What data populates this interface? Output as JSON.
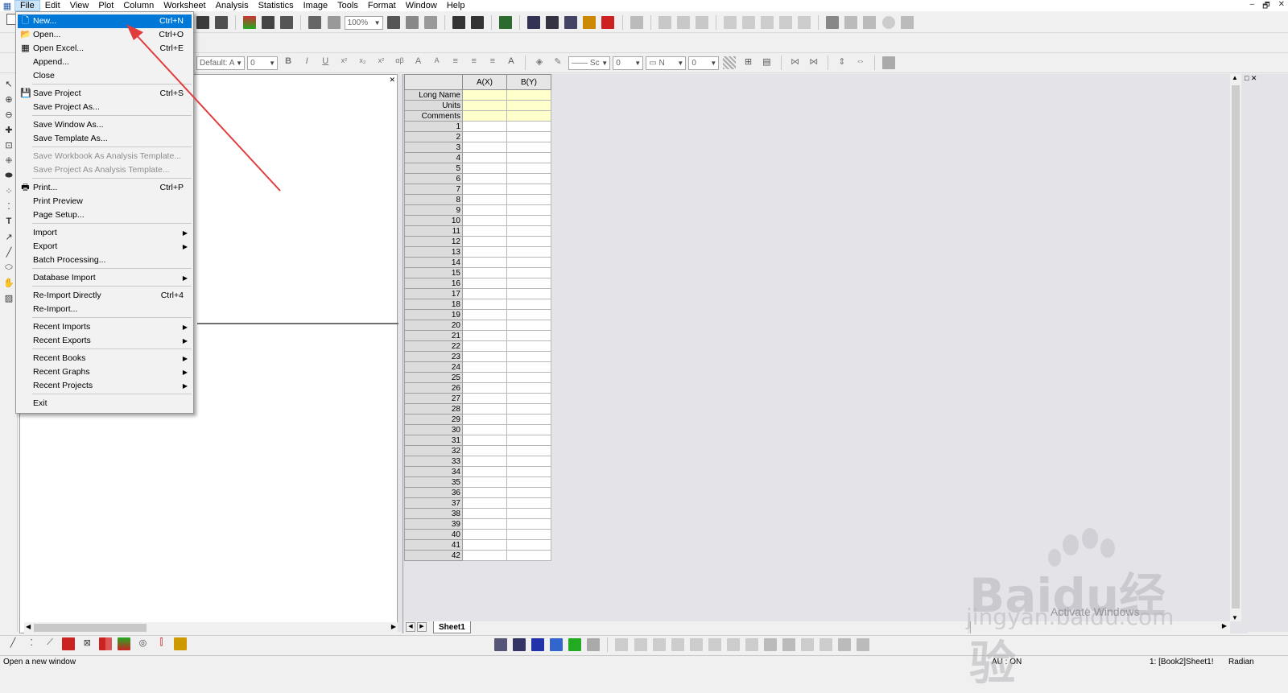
{
  "menubar": {
    "items": [
      "File",
      "Edit",
      "View",
      "Plot",
      "Column",
      "Worksheet",
      "Analysis",
      "Statistics",
      "Image",
      "Tools",
      "Format",
      "Window",
      "Help"
    ]
  },
  "window_controls": {
    "minimize": "–",
    "restore": "🗗",
    "close": "✕"
  },
  "toolbar": {
    "zoom": "100%",
    "font_combo": "Default: A",
    "font_size": "0",
    "line_style": "Sc",
    "line_width": "0",
    "border_combo": "N",
    "border_width": "0"
  },
  "file_menu": {
    "items": [
      {
        "label": "New...",
        "shortcut": "Ctrl+N",
        "icon": "new-icon"
      },
      {
        "label": "Open...",
        "shortcut": "Ctrl+O",
        "icon": "open-folder-icon"
      },
      {
        "label": "Open Excel...",
        "shortcut": "Ctrl+E",
        "icon": "excel-icon"
      },
      {
        "label": "Append...",
        "shortcut": ""
      },
      {
        "label": "Close",
        "shortcut": ""
      },
      {
        "label": "Save Project",
        "shortcut": "Ctrl+S",
        "icon": "save-icon"
      },
      {
        "label": "Save Project As...",
        "shortcut": ""
      },
      {
        "label": "Save Window As...",
        "shortcut": ""
      },
      {
        "label": "Save Template As...",
        "shortcut": ""
      },
      {
        "label": "Save Workbook As Analysis Template...",
        "shortcut": ""
      },
      {
        "label": "Save Project As Analysis Template...",
        "shortcut": ""
      },
      {
        "label": "Print...",
        "shortcut": "Ctrl+P",
        "icon": "printer-icon"
      },
      {
        "label": "Print Preview",
        "shortcut": ""
      },
      {
        "label": "Page Setup...",
        "shortcut": ""
      },
      {
        "label": "Import",
        "shortcut": ""
      },
      {
        "label": "Export",
        "shortcut": ""
      },
      {
        "label": "Batch Processing...",
        "shortcut": ""
      },
      {
        "label": "Database Import",
        "shortcut": ""
      },
      {
        "label": "Re-Import Directly",
        "shortcut": "Ctrl+4"
      },
      {
        "label": "Re-Import...",
        "shortcut": ""
      },
      {
        "label": "Recent Imports",
        "shortcut": ""
      },
      {
        "label": "Recent Exports",
        "shortcut": ""
      },
      {
        "label": "Recent Books",
        "shortcut": ""
      },
      {
        "label": "Recent Graphs",
        "shortcut": ""
      },
      {
        "label": "Recent Projects",
        "shortcut": ""
      },
      {
        "label": "Exit",
        "shortcut": ""
      }
    ]
  },
  "worksheet": {
    "columns": [
      "A(X)",
      "B(Y)"
    ],
    "meta_rows": [
      "Long Name",
      "Units",
      "Comments"
    ],
    "row_numbers": [
      "1",
      "2",
      "3",
      "4",
      "5",
      "6",
      "7",
      "8",
      "9",
      "10",
      "11",
      "12",
      "13",
      "14",
      "15",
      "16",
      "17",
      "18",
      "19",
      "20",
      "21",
      "22",
      "23",
      "24",
      "25",
      "26",
      "27",
      "28",
      "29",
      "30",
      "31",
      "32",
      "33",
      "34",
      "35",
      "36",
      "37",
      "38",
      "39",
      "40",
      "41",
      "42"
    ],
    "sheet_tab": "Sheet1"
  },
  "statusbar": {
    "message": "Open a new window",
    "au": "AU : ON",
    "window_ref": "1: [Book2]Sheet1!",
    "angle_unit": "Radian"
  },
  "watermark": {
    "logo": "Baidu经验",
    "url": "jingyan.baidu.com"
  },
  "activate_windows": "Activate Windows",
  "colors": {
    "highlight": "#0078d7",
    "meta_cell": "#ffffcc",
    "arrow": "#e03c3c"
  }
}
